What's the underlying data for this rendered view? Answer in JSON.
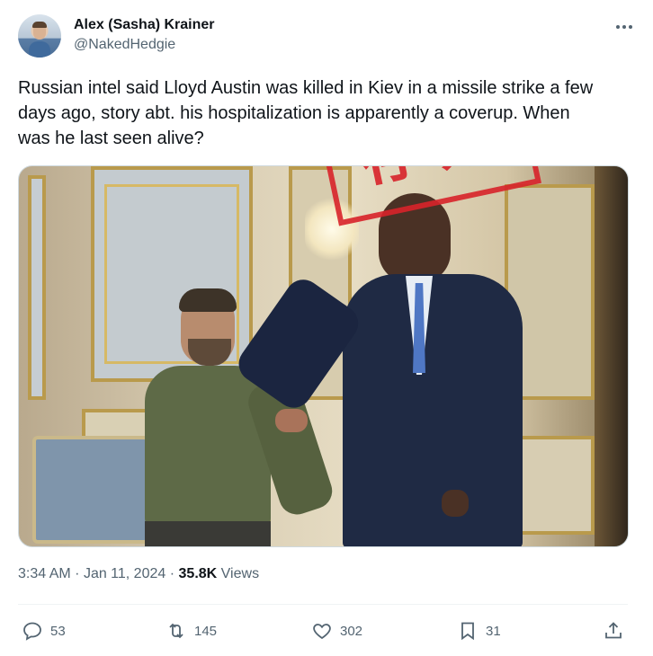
{
  "author": {
    "name": "Alex (Sasha) Krainer",
    "handle": "@NakedHedgie"
  },
  "tweet": {
    "text": "Russian intel said Lloyd Austin was killed in Kiev in a missile strike a few\ndays ago, story abt. his hospitalization is apparently a coverup. When\nwas he last seen alive?"
  },
  "stamp": {
    "char1": "存",
    "char2": "疑",
    "color": "#d8232a"
  },
  "meta": {
    "time": "3:34 AM",
    "sep1": "·",
    "date": "Jan 11, 2024",
    "sep2": "·",
    "views_count": "35.8K",
    "views_label": "Views"
  },
  "actions": {
    "replies": "53",
    "reposts": "145",
    "likes": "302",
    "bookmarks": "31"
  },
  "icons": [
    "more-icon",
    "reply-icon",
    "repost-icon",
    "like-icon",
    "bookmark-icon",
    "share-icon"
  ]
}
